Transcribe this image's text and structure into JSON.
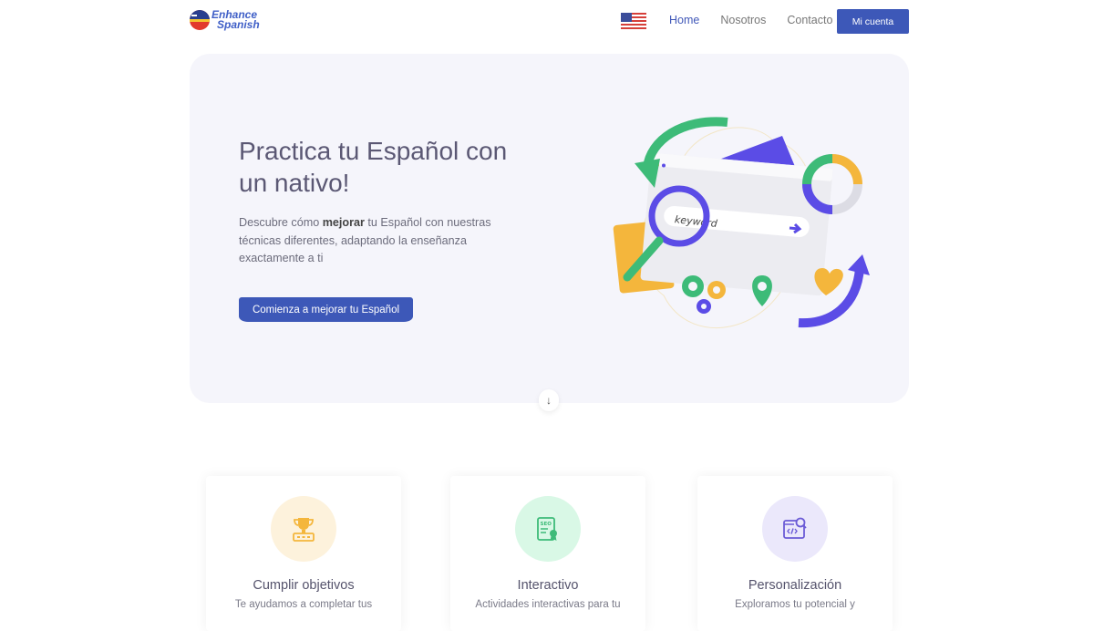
{
  "header": {
    "logo_line1": "Enhance",
    "logo_line2": "Spanish",
    "language_icon": "us-flag-icon",
    "nav": [
      {
        "label": "Home",
        "active": true
      },
      {
        "label": "Nosotros",
        "active": false
      },
      {
        "label": "Contacto",
        "active": false
      }
    ],
    "account_button": "Mi cuenta"
  },
  "hero": {
    "title": "Practica tu Español con un nativo!",
    "desc_pre": "Descubre cómo ",
    "desc_bold": "mejorar",
    "desc_post": " tu Español con nuestras técnicas diferentes, adaptando la enseñanza exactamente a ti",
    "cta": "Comienza a mejorar tu Español",
    "illustration_text": "keyword",
    "scroll_icon": "arrow-down-icon"
  },
  "features": [
    {
      "icon": "trophy-icon",
      "title": "Cumplir objetivos",
      "desc": "Te ayudamos a completar tus",
      "bg": "#fdf2dc",
      "color": "#f4b63c"
    },
    {
      "icon": "seo-certificate-icon",
      "title": "Interactivo",
      "desc": "Actividades interactivas para tu",
      "bg": "#d9f8e6",
      "color": "#3dbb78"
    },
    {
      "icon": "code-search-icon",
      "title": "Personalización",
      "desc": "Exploramos tu potencial y",
      "bg": "#ebe8fb",
      "color": "#6b5bd6"
    }
  ],
  "colors": {
    "primary": "#3d58b8",
    "hero_bg": "#f5f5fb",
    "accent_green": "#3dbb78",
    "accent_purple": "#5b4ce6",
    "accent_yellow": "#f4b63c"
  }
}
